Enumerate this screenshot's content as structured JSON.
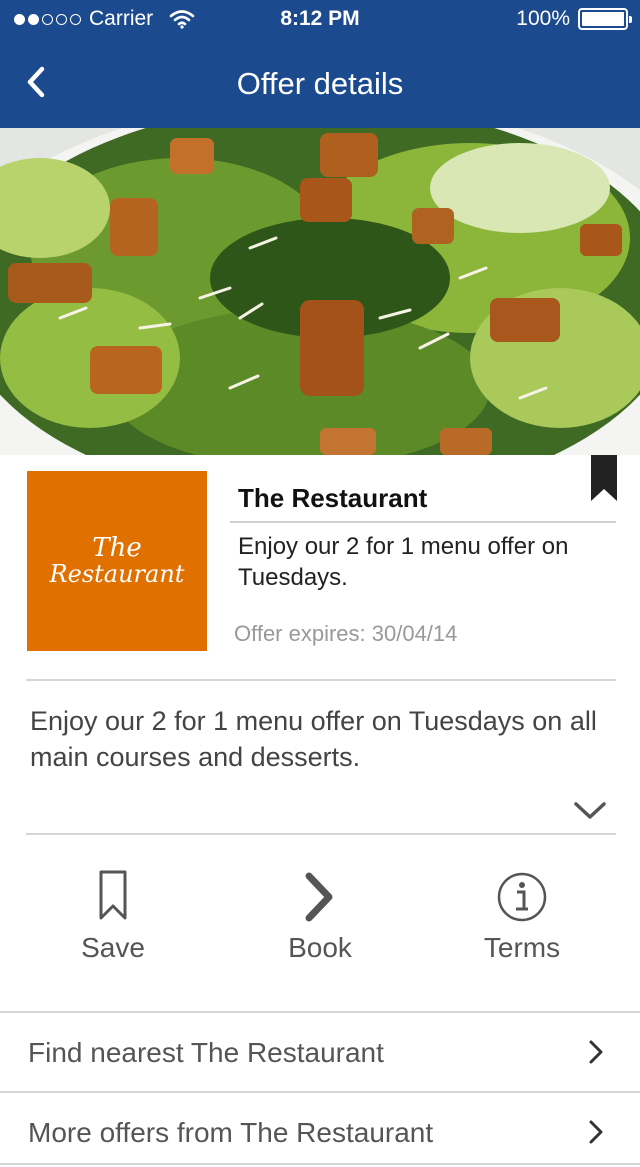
{
  "status_bar": {
    "carrier": "Carrier",
    "time": "8:12 PM",
    "battery": "100%"
  },
  "nav": {
    "title": "Offer details"
  },
  "offer": {
    "restaurant_name": "The Restaurant",
    "logo_line1": "The",
    "logo_line2": "Restaurant",
    "short_description": "Enjoy our 2 for 1 menu offer on Tuesdays.",
    "expires": "Offer expires: 30/04/14",
    "long_description": "Enjoy our 2 for 1 menu offer on Tuesdays on all main courses and desserts."
  },
  "actions": {
    "save": "Save",
    "book": "Book",
    "terms": "Terms"
  },
  "links": {
    "find_nearest": "Find nearest The Restaurant",
    "more_offers": "More offers from The Restaurant"
  },
  "colors": {
    "header": "#1c4a8e",
    "logo": "#e07000"
  },
  "icons": [
    "back-chevron-icon",
    "wifi-icon",
    "battery-icon",
    "bookmark-icon",
    "chevron-down-icon",
    "bookmark-outline-icon",
    "chevron-right-icon",
    "info-circle-icon"
  ]
}
